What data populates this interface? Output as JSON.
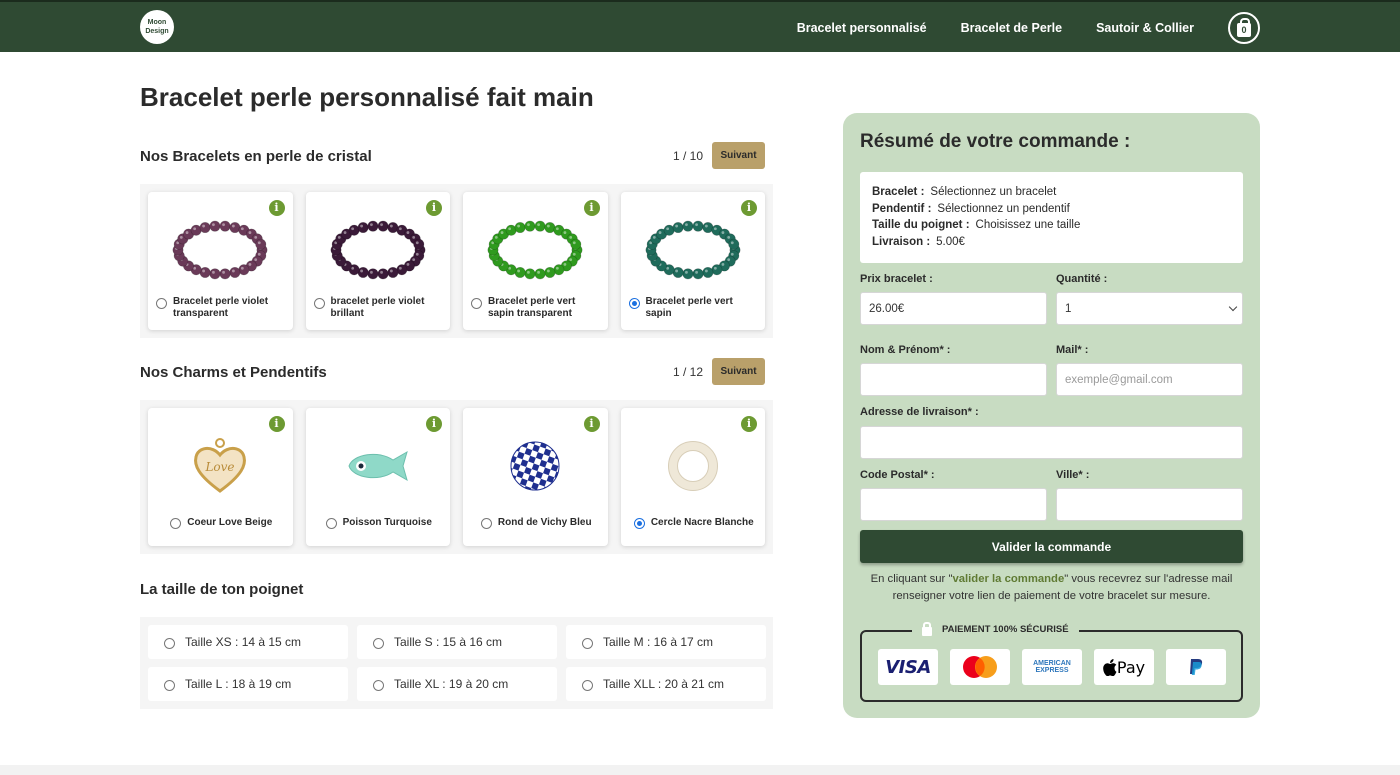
{
  "header": {
    "logo_text": "Moon Design",
    "nav": [
      "Bracelet personnalisé",
      "Bracelet de Perle",
      "Sautoir & Collier"
    ],
    "cart_count": "0"
  },
  "page_title": "Bracelet perle personnalisé fait main",
  "bracelets": {
    "title": "Nos Bracelets en perle de cristal",
    "pager": "1 / 10",
    "next_label": "Suivant",
    "items": [
      {
        "label": "Bracelet perle violet transparent",
        "color": "#6a3a58",
        "selected": false
      },
      {
        "label": "bracelet perle violet brillant",
        "color": "#3a1a38",
        "selected": false
      },
      {
        "label": "Bracelet perle vert sapin transparent",
        "color": "#2f9a1e",
        "selected": false
      },
      {
        "label": "Bracelet perle vert sapin",
        "color": "#1f6b5b",
        "selected": true
      }
    ]
  },
  "charms": {
    "title": "Nos Charms et Pendentifs",
    "pager": "1 / 12",
    "next_label": "Suivant",
    "items": [
      {
        "label": "Coeur Love Beige",
        "engraving": "Love",
        "selected": false
      },
      {
        "label": "Poisson Turquoise",
        "selected": false
      },
      {
        "label": "Rond de Vichy Bleu",
        "selected": false
      },
      {
        "label": "Cercle Nacre Blanche",
        "selected": true
      }
    ]
  },
  "sizes": {
    "title": "La taille de ton poignet",
    "options": [
      "Taille XS : 14 à 15 cm",
      "Taille S : 15 à 16 cm",
      "Taille M : 16 à 17 cm",
      "Taille L : 18 à 19 cm",
      "Taille XL : 19 à 20 cm",
      "Taille XLL : 20 à 21 cm"
    ]
  },
  "summary": {
    "title": "Résumé de votre commande :",
    "lines": [
      {
        "key": "Bracelet :",
        "value": "Sélectionnez un bracelet"
      },
      {
        "key": "Pendentif :",
        "value": "Sélectionnez un pendentif"
      },
      {
        "key": "Taille du poignet :",
        "value": "Choisissez une taille"
      },
      {
        "key": "Livraison :",
        "value": "5.00€"
      }
    ],
    "price_label": "Prix bracelet :",
    "price_value": "26.00€",
    "qty_label": "Quantité :",
    "qty_value": "1",
    "name_label": "Nom & Prénom* :",
    "mail_label": "Mail* :",
    "mail_placeholder": "exemple@gmail.com",
    "address_label": "Adresse de livraison* :",
    "zip_label": "Code Postal* :",
    "city_label": "Ville* :",
    "validate_label": "Valider la commande",
    "note_before": "En cliquant sur \"",
    "note_highlight": "valider la commande",
    "note_after": "\" vous recevrez sur l'adresse mail renseigner votre lien de paiement de votre bracelet sur mesure.",
    "secure_label": "PAIEMENT 100% SÉCURISÉ",
    "payments": {
      "visa": "VISA",
      "amex_1": "AMERICAN",
      "amex_2": "EXPRESS",
      "applepay": "Pay"
    }
  },
  "colors": {
    "header": "#2f4a33",
    "accent": "#b9a06a",
    "panel": "#c8dcc2",
    "info": "#6d9a32"
  }
}
